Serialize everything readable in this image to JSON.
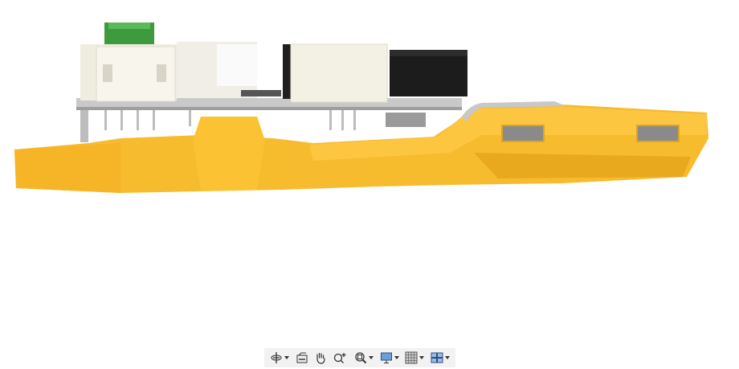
{
  "viewport": {
    "model": "3d-model-pcb-on-yellow-mount"
  },
  "colors": {
    "mount": "#f7bb2e",
    "pcb": "#c9c9c9",
    "button": "#3d9a3d",
    "connector_white": "#f3f0e4",
    "connector_black": "#1c1c1c",
    "toolbar_bg": "#f2f2f2"
  },
  "toolbar": {
    "items": [
      {
        "icon": "orbit-icon",
        "has_dropdown": true
      },
      {
        "icon": "look-at-icon",
        "has_dropdown": false
      },
      {
        "icon": "pan-icon",
        "has_dropdown": false
      },
      {
        "icon": "zoom-icon",
        "has_dropdown": false
      },
      {
        "icon": "fit-icon",
        "has_dropdown": true
      },
      {
        "icon": "display-settings-icon",
        "has_dropdown": true
      },
      {
        "icon": "grid-icon",
        "has_dropdown": true
      },
      {
        "icon": "viewports-icon",
        "has_dropdown": true
      }
    ]
  }
}
